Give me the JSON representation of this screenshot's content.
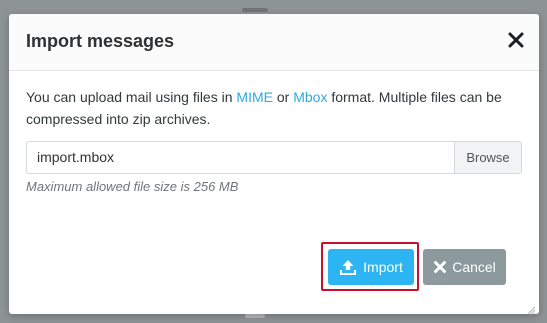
{
  "dialog": {
    "title": "Import messages",
    "close_icon": "close-icon",
    "description": {
      "before_mime": "You can upload mail using files in ",
      "mime_link": "MIME",
      "between": " or ",
      "mbox_link": "Mbox",
      "after_mbox": " format. Multiple files can be compressed into zip archives."
    },
    "file_input_value": "import.mbox",
    "browse_label": "Browse",
    "hint": "Maximum allowed file size is 256 MB",
    "import_label": "Import",
    "import_icon": "upload-icon",
    "cancel_label": "Cancel",
    "cancel_icon": "close-icon"
  },
  "colors": {
    "accent": "#2db4f2",
    "link": "#2eaadf",
    "cancel": "#8c9a9d",
    "highlight": "#c8102e",
    "backdrop": "#8e9494"
  }
}
